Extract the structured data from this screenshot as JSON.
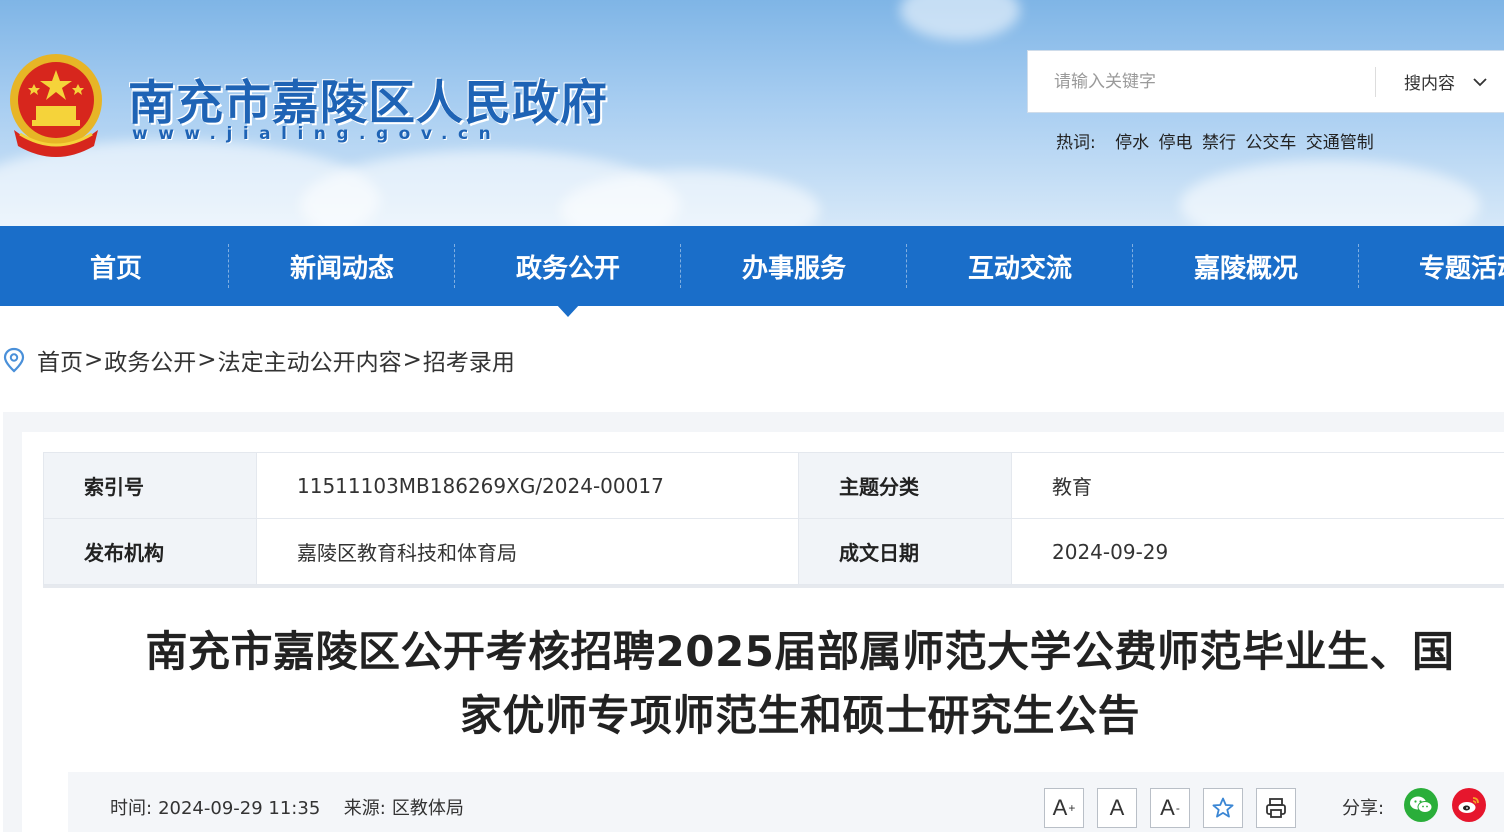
{
  "header": {
    "site_name": "南充市嘉陵区人民政府",
    "site_url": "www.jialing.gov.cn",
    "search": {
      "placeholder": "请输入关键字",
      "scope": "搜内容"
    },
    "hot": {
      "label": "热词:",
      "words": [
        "停水",
        "停电",
        "禁行",
        "公交车",
        "交通管制"
      ]
    }
  },
  "nav": {
    "items": [
      "首页",
      "新闻动态",
      "政务公开",
      "办事服务",
      "互动交流",
      "嘉陵概况",
      "专题活动"
    ],
    "active": "政务公开"
  },
  "breadcrumb": {
    "items": [
      "首页",
      "政务公开",
      "法定主动公开内容",
      "招考录用"
    ],
    "separator": ">"
  },
  "meta": {
    "index_label": "索引号",
    "index_value": "11511103MB186269XG/2024-00017",
    "topic_label": "主题分类",
    "topic_value": "教育",
    "org_label": "发布机构",
    "org_value": "嘉陵区教育科技和体育局",
    "date_label": "成文日期",
    "date_value": "2024-09-29"
  },
  "article": {
    "title_line1": "南充市嘉陵区公开考核招聘2025届部属师范大学公费师范毕业生、国",
    "title_line2": "家优师专项师范生和硕士研究生公告",
    "time_label": "时间:",
    "time_value": "2024-09-29 11:35",
    "source_label": "来源:",
    "source_value": "区教体局"
  },
  "toolbar": {
    "font_larger": "A",
    "font_default": "A",
    "font_smaller": "A",
    "share_label": "分享:"
  },
  "colors": {
    "brand_blue": "#1a6ec9",
    "title_blue": "#1e63b5",
    "wechat_green": "#2aae3a",
    "weibo_red": "#e6162d"
  }
}
